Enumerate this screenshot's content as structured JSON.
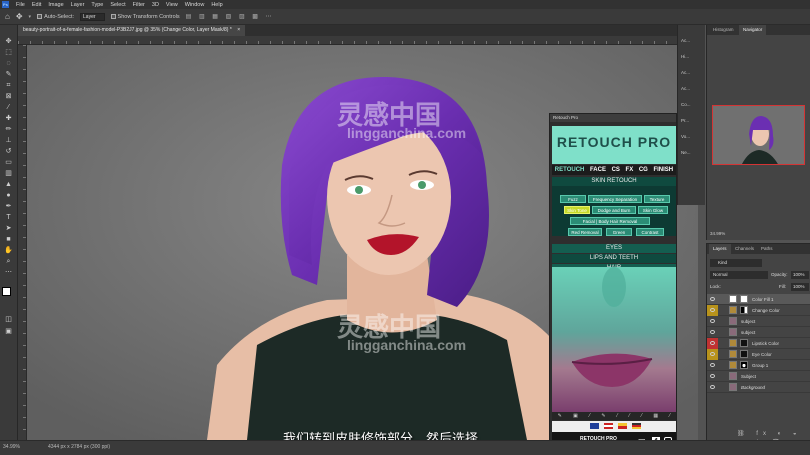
{
  "menubar": {
    "app_icon": "Ps",
    "items": [
      "File",
      "Edit",
      "Image",
      "Layer",
      "Type",
      "Select",
      "Filter",
      "3D",
      "View",
      "Window",
      "Help"
    ]
  },
  "options": {
    "auto_select": "Auto-Select:",
    "target": "Layer",
    "show_transform": "Show Transform Controls"
  },
  "document": {
    "tab_title": "beauty-portrait-of-a-female-fashion-model-P3B2J7.jpg @ 35% (Change Color, Layer Mask/8) *"
  },
  "status": {
    "zoom": "34.99%",
    "doc_info": "4344 px x 2784 px (300 ppi)"
  },
  "subtitle": "我们转到皮肤修饰部分，然后选择",
  "watermark": {
    "cn": "灵感中国",
    "en": "lingganchina.com"
  },
  "retouch_panel": {
    "title": "Retouch Pro",
    "logo": "RETOUCH PRO",
    "nav": [
      "RETOUCH",
      "FACE",
      "CS",
      "FX",
      "CG",
      "FINISH"
    ],
    "nav_active": "RETOUCH",
    "skin_header": "SKIN RETOUCH",
    "buttons": {
      "fuzz": "Fuzz",
      "freq_sep": "Frequency Separation",
      "texture": "Texture",
      "skin_tone": "Skin Tone",
      "dodge_burn": "Dodge and Burn",
      "skin_glow": "Skin Glow",
      "facial_hair": "Facial | Body Hair Removal",
      "red_removal": "Red Removal",
      "green": "Green",
      "contrast": "Contrast"
    },
    "sections": [
      "EYES",
      "LIPS AND TEETH",
      "HAIR"
    ],
    "footer_brand": "RETOUCH PRO",
    "footer_version": "V. 1.0.0"
  },
  "mini_strip": [
    "Ac...",
    "Hi...",
    "Ac...",
    "Ac...",
    "Co...",
    "Pr...",
    "Vo...",
    "Ne..."
  ],
  "navigator": {
    "tabs": [
      "Histogram",
      "Navigator"
    ],
    "active": "Navigator",
    "zoom": "34.99%"
  },
  "layers_panel": {
    "tabs": [
      "Layers",
      "Channels",
      "Paths"
    ],
    "kind": "Kind",
    "blend": "Normal",
    "opacity_label": "Opacity:",
    "opacity": "100%",
    "lock_label": "Lock:",
    "fill_label": "Fill:",
    "fill": "100%",
    "layers": [
      {
        "name": "Color Fill 1",
        "tag": "",
        "mask": "white"
      },
      {
        "name": "Change Color",
        "tag": "#b8931c",
        "mask": "folder"
      },
      {
        "name": "subject",
        "tag": "",
        "mask": "photo"
      },
      {
        "name": "subject",
        "tag": "",
        "mask": "photo"
      },
      {
        "name": "Lipstick Color",
        "tag": "#c03232",
        "mask": "black"
      },
      {
        "name": "Eye Color",
        "tag": "#b8931c",
        "mask": "black"
      },
      {
        "name": "Group 1",
        "tag": "",
        "mask": "bw"
      },
      {
        "name": "Subject",
        "tag": "",
        "mask": "photo"
      },
      {
        "name": "Background",
        "tag": "",
        "mask": "photo"
      }
    ]
  },
  "colors": {
    "accent": "#7fe0c9",
    "panel_dark": "#0f4a3f",
    "hair": "#6b2fb2"
  }
}
